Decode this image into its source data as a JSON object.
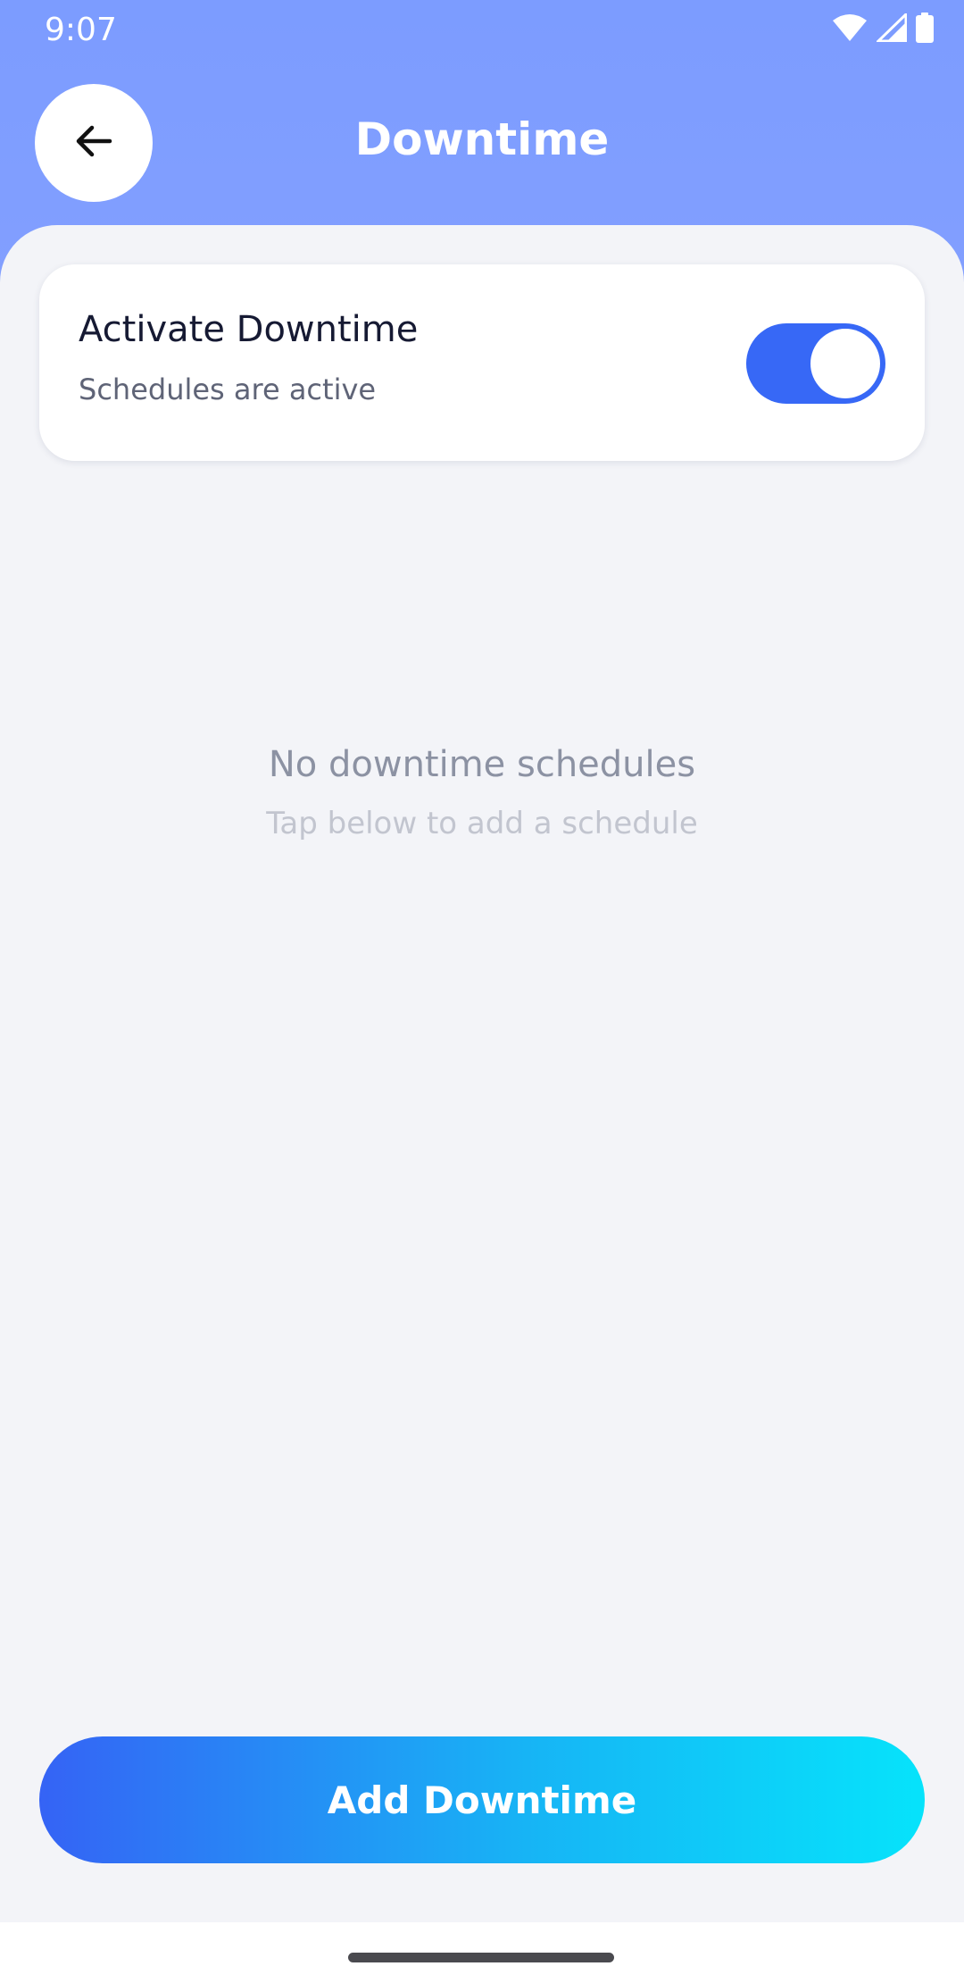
{
  "status_bar": {
    "time": "9:07",
    "icons": [
      "wifi-icon",
      "cell-signal-icon",
      "battery-icon"
    ]
  },
  "header": {
    "title": "Downtime",
    "back_icon": "arrow-left-icon"
  },
  "toggle_card": {
    "title": "Activate Downtime",
    "subtitle": "Schedules are active",
    "enabled": true
  },
  "empty_state": {
    "title": "No downtime schedules",
    "subtitle": "Tap below to add a schedule"
  },
  "add_button": {
    "label": "Add Downtime"
  },
  "colors": {
    "header_bg": "#829FFF",
    "content_bg": "#F3F4F8",
    "toggle_on": "#3768F6",
    "button_gradient_start": "#3563F5",
    "button_gradient_end": "#06E3FB"
  }
}
